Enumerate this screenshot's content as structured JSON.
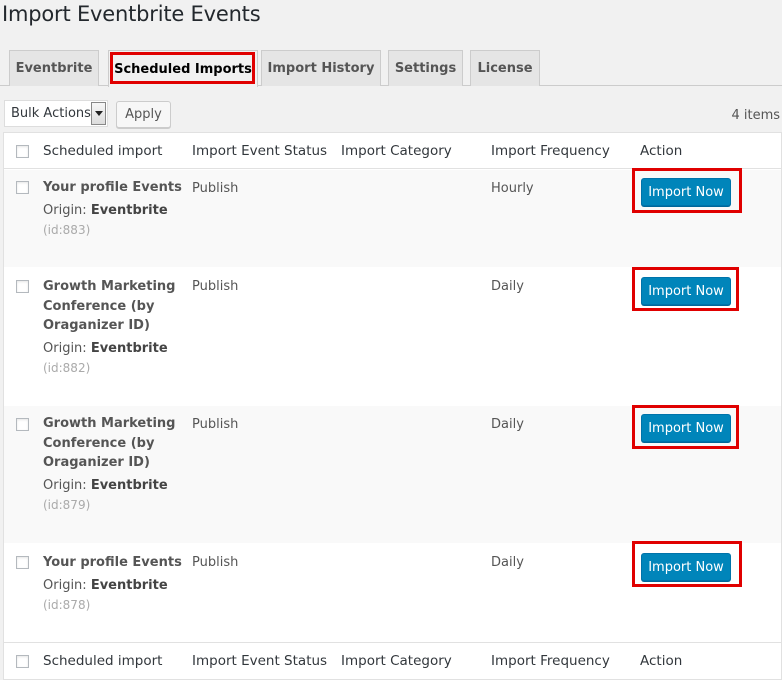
{
  "page": {
    "title": "Import Eventbrite Events"
  },
  "tabs": [
    {
      "label": "Eventbrite"
    },
    {
      "label": "Scheduled Imports"
    },
    {
      "label": "Import History"
    },
    {
      "label": "Settings"
    },
    {
      "label": "License"
    }
  ],
  "toolbar": {
    "bulk_actions": "Bulk Actions",
    "apply": "Apply",
    "items_count": "4 items"
  },
  "columns": [
    "Scheduled import",
    "Import Event Status",
    "Import Category",
    "Import Frequency",
    "Action"
  ],
  "rows": [
    {
      "title": "Your profile Events",
      "origin_label": "Origin:",
      "origin": "Eventbrite",
      "id": "(id:883)",
      "status": "Publish",
      "category": "",
      "frequency": "Hourly",
      "action": "Import Now"
    },
    {
      "title": "Growth Marketing Conference (by Oraganizer ID)",
      "title_lines": [
        "Growth Marketing",
        "Conference (by",
        "Oraganizer ID)"
      ],
      "origin_label": "Origin:",
      "origin": "Eventbrite",
      "id": "(id:882)",
      "status": "Publish",
      "category": "",
      "frequency": "Daily",
      "action": "Import Now"
    },
    {
      "title": "Growth Marketing Conference (by Oraganizer ID)",
      "title_lines": [
        "Growth Marketing",
        "Conference (by",
        "Oraganizer ID)"
      ],
      "origin_label": "Origin:",
      "origin": "Eventbrite",
      "id": "(id:879)",
      "status": "Publish",
      "category": "",
      "frequency": "Daily",
      "action": "Import Now"
    },
    {
      "title": "Your profile Events",
      "origin_label": "Origin:",
      "origin": "Eventbrite",
      "id": "(id:878)",
      "status": "Publish",
      "category": "",
      "frequency": "Daily",
      "action": "Import Now"
    }
  ],
  "colors": {
    "primary_button": "#0085ba",
    "highlight": "#e00000",
    "background": "#f1f1f1"
  }
}
